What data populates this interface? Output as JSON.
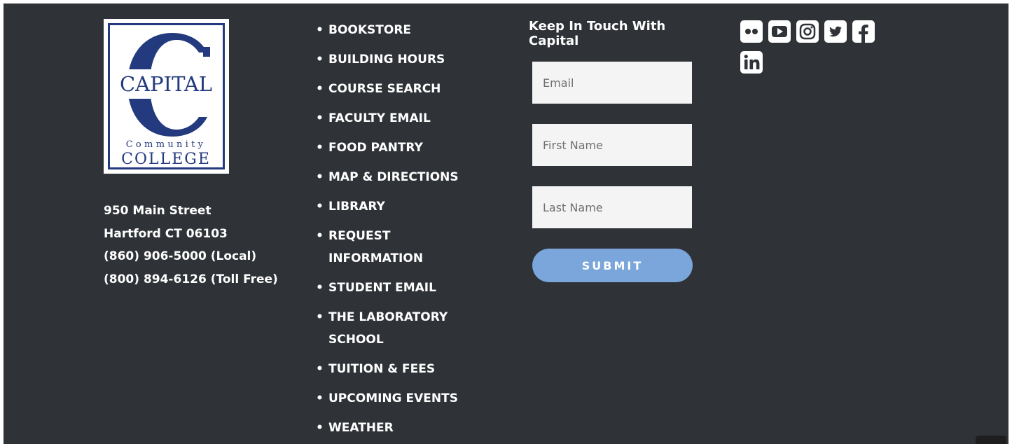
{
  "logo": {
    "name_top": "CAPITAL",
    "name_mid": "Community",
    "name_bottom": "COLLEGE"
  },
  "address": {
    "street": "950 Main Street",
    "city": "Hartford CT 06103",
    "phone_local": "(860) 906-5000 (Local)",
    "phone_toll_free": "(800) 894-6126 (Toll Free)"
  },
  "links": [
    {
      "label": "BOOKSTORE"
    },
    {
      "label": "BUILDING HOURS"
    },
    {
      "label": "COURSE SEARCH"
    },
    {
      "label": "FACULTY EMAIL"
    },
    {
      "label": "FOOD PANTRY"
    },
    {
      "label": "MAP & DIRECTIONS"
    },
    {
      "label": "LIBRARY"
    },
    {
      "label": "REQUEST INFORMATION"
    },
    {
      "label": "STUDENT EMAIL"
    },
    {
      "label": "THE LABORATORY SCHOOL"
    },
    {
      "label": "TUITION & FEES"
    },
    {
      "label": "UPCOMING EVENTS"
    },
    {
      "label": "WEATHER"
    }
  ],
  "form": {
    "title": "Keep In Touch With Capital",
    "email_placeholder": "Email",
    "first_name_placeholder": "First Name",
    "last_name_placeholder": "Last Name",
    "submit_label": "SUBMIT"
  },
  "social": {
    "icons": [
      "flickr-icon",
      "youtube-icon",
      "instagram-icon",
      "twitter-icon",
      "facebook-icon",
      "linkedin-icon"
    ]
  },
  "colors": {
    "background": "#2f3237",
    "brand_navy": "#243a7e",
    "submit": "#7aa6dc",
    "field": "#f4f4f4",
    "text": "#ffffff"
  }
}
